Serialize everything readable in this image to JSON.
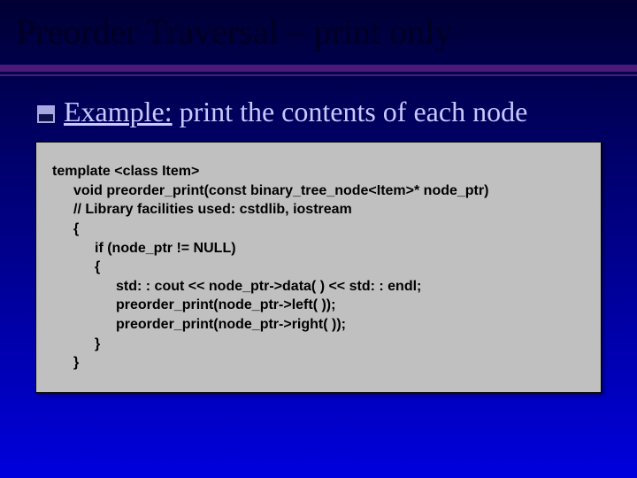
{
  "title": "Preorder Traversal – print only",
  "bullet": {
    "lead": "Example:",
    "rest": " print the contents of each node"
  },
  "code": {
    "l0": "template <class Item>",
    "l1": "void preorder_print(const binary_tree_node<Item>* node_ptr)",
    "l2": "// Library facilities used: cstdlib, iostream",
    "l3": "{",
    "l4": "if (node_ptr != NULL)",
    "l5": "{",
    "l6": "std: : cout <<  node_ptr->data( ) << std: : endl;",
    "l7": "preorder_print(node_ptr->left( ));",
    "l8": "preorder_print(node_ptr->right( ));",
    "l9": "}",
    "l10": "}"
  }
}
